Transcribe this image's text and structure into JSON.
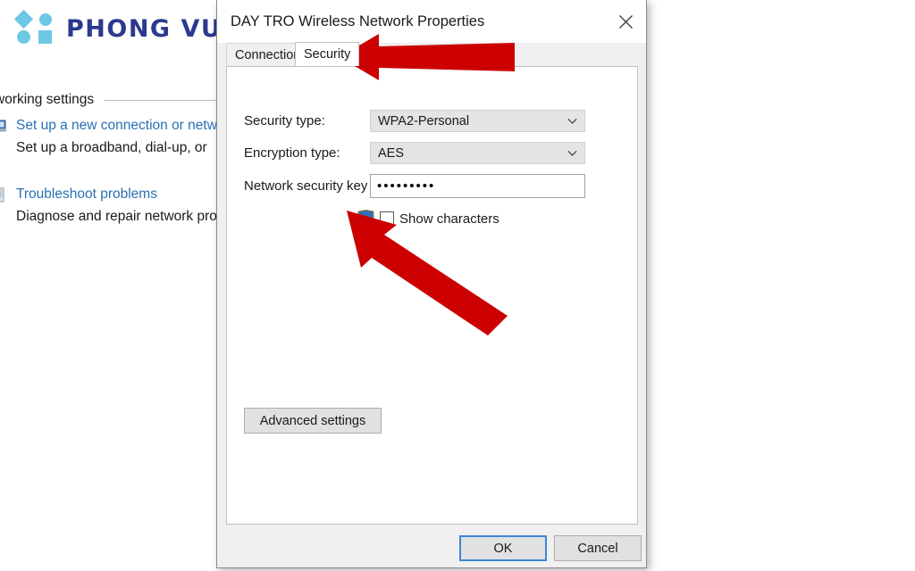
{
  "background": {
    "brand": {
      "name": "PHONG VU",
      "mark_color": "#6fc7e6",
      "text_color": "#2b3a8f",
      "shapes": [
        "diamond",
        "circle",
        "circle",
        "square"
      ]
    },
    "network_settings_heading": "your networking settings",
    "items": [
      {
        "icon": "new-connection-icon",
        "link": "Set up a new connection or netw",
        "description": "Set up a broadband, dial-up, or "
      },
      {
        "icon": "troubleshoot-icon",
        "link": "Troubleshoot problems",
        "description": "Diagnose and repair network pro"
      }
    ],
    "link_color": "#2a6fb5"
  },
  "dialog": {
    "title": "DAY TRO Wireless Network Properties",
    "close_icon": "close-icon",
    "tabs": [
      {
        "label": "Connection",
        "active": false
      },
      {
        "label": "Security",
        "active": true
      }
    ],
    "fields": {
      "security_type": {
        "label": "Security type:",
        "value": "WPA2-Personal",
        "control": "dropdown",
        "chevron": "chevron-down-icon"
      },
      "encryption_type": {
        "label": "Encryption type:",
        "value": "AES",
        "control": "dropdown",
        "chevron": "chevron-down-icon"
      },
      "network_security_key": {
        "label": "Network security key",
        "value": "•••••••••",
        "masked_char_count": 9,
        "control": "password"
      }
    },
    "show_characters": {
      "label": "Show characters",
      "checked": false,
      "shield_icon": "uac-shield-icon"
    },
    "advanced_settings_label": "Advanced settings",
    "footer": {
      "ok_label": "OK",
      "cancel_label": "Cancel",
      "focused_button": "OK",
      "focus_color": "#3a87d8"
    }
  },
  "annotations": {
    "color": "#cc0000",
    "arrows": [
      {
        "name": "arrow-pointing-to-security-tab",
        "direction": "left",
        "target": "Security tab"
      },
      {
        "name": "arrow-pointing-to-show-characters",
        "direction": "up-left",
        "target": "Show characters checkbox"
      }
    ]
  }
}
